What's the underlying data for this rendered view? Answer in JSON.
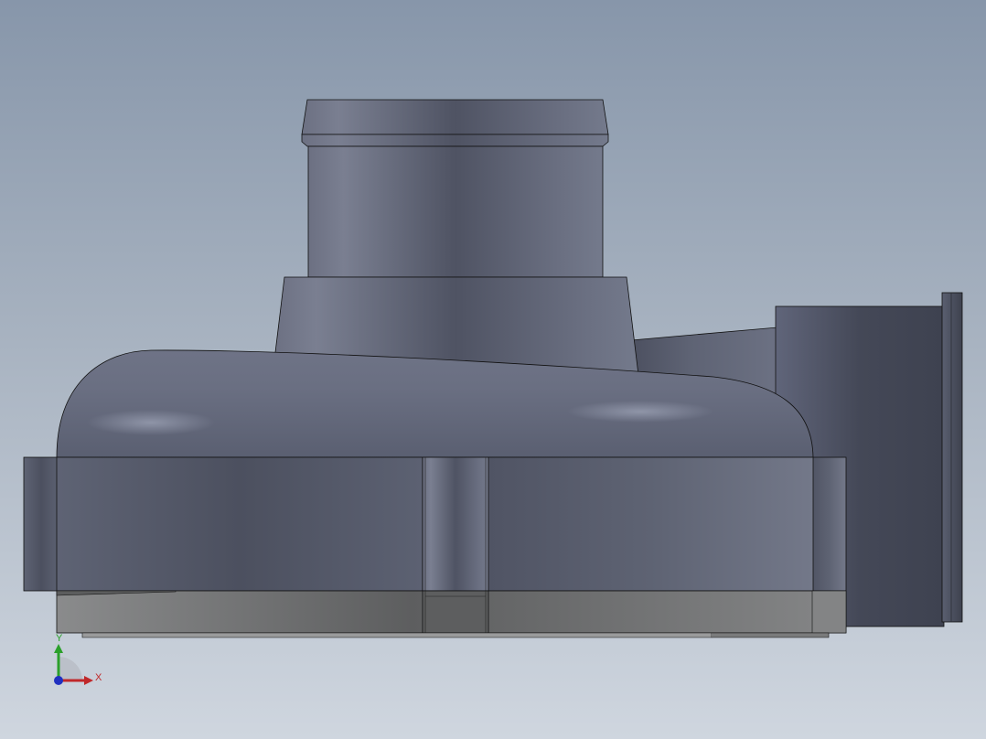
{
  "viewport": {
    "background_top": "#8796aa",
    "background_bottom": "#cfd6df"
  },
  "model": {
    "body_color": "#5f6475",
    "edge_color": "#111111",
    "base_plate_color": "#6c6d6e"
  },
  "triad": {
    "x_label": "X",
    "y_label": "Y",
    "x_color": "#c0282a",
    "y_color": "#2aa02a",
    "z_color": "#2030c0"
  }
}
